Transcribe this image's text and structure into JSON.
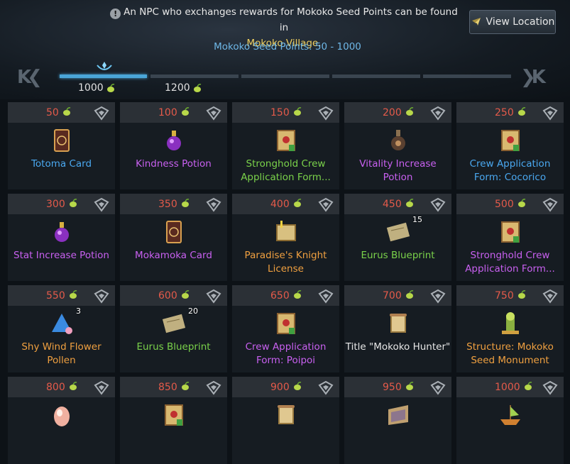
{
  "notice": {
    "text": "An NPC who exchanges rewards for Mokoko Seed Points can be found in",
    "location": "Mokoko Village",
    "period": "."
  },
  "view_location_label": "View Location",
  "points_range_label": "Mokoko Seed Points: 50 - 1000",
  "timeline": {
    "labels": [
      "1000",
      "1200"
    ],
    "active_segment": 1,
    "segment_count": 5
  },
  "colors": {
    "cost": "#e45a4a",
    "common": "#e6e6e6",
    "uncommon": "#7ad24a",
    "rare": "#4aa8f0",
    "epic": "#c860f0",
    "legendary": "#f0a040",
    "accent": "#4aa6d8"
  },
  "rewards": [
    {
      "cost": "50",
      "name": "Totoma Card",
      "rarity": "rare",
      "icon": "card-icon",
      "qty": ""
    },
    {
      "cost": "100",
      "name": "Kindness Potion",
      "rarity": "epic",
      "icon": "potion-icon",
      "qty": ""
    },
    {
      "cost": "150",
      "name": "Stronghold Crew Application Form...",
      "rarity": "uncommon",
      "icon": "application-form-icon",
      "qty": ""
    },
    {
      "cost": "200",
      "name": "Vitality Increase Potion",
      "rarity": "epic",
      "icon": "flask-icon",
      "qty": ""
    },
    {
      "cost": "250",
      "name": "Crew Application Form: Cocorico",
      "rarity": "rare",
      "icon": "application-form-icon",
      "qty": ""
    },
    {
      "cost": "300",
      "name": "Stat Increase Potion",
      "rarity": "epic",
      "icon": "potion-icon",
      "qty": ""
    },
    {
      "cost": "350",
      "name": "Mokamoka Card",
      "rarity": "epic",
      "icon": "card-icon",
      "qty": ""
    },
    {
      "cost": "400",
      "name": "Paradise's Knight License",
      "rarity": "legendary",
      "icon": "license-icon",
      "qty": ""
    },
    {
      "cost": "450",
      "name": "Eurus Blueprint",
      "rarity": "uncommon",
      "icon": "blueprint-icon",
      "qty": "15"
    },
    {
      "cost": "500",
      "name": "Stronghold Crew Application Form...",
      "rarity": "epic",
      "icon": "application-form-icon",
      "qty": ""
    },
    {
      "cost": "550",
      "name": "Shy Wind Flower Pollen",
      "rarity": "legendary",
      "icon": "pollen-icon",
      "qty": "3"
    },
    {
      "cost": "600",
      "name": "Eurus Blueprint",
      "rarity": "uncommon",
      "icon": "blueprint-icon",
      "qty": "20"
    },
    {
      "cost": "650",
      "name": "Crew Application Form: Poipoi",
      "rarity": "epic",
      "icon": "application-form-icon",
      "qty": ""
    },
    {
      "cost": "700",
      "name": "Title \"Mokoko Hunter\"",
      "rarity": "common",
      "icon": "scroll-icon",
      "qty": ""
    },
    {
      "cost": "750",
      "name": "Structure: Mokoko Seed Monument",
      "rarity": "legendary",
      "icon": "monument-icon",
      "qty": ""
    },
    {
      "cost": "800",
      "name": "",
      "rarity": "legendary",
      "icon": "egg-icon",
      "qty": ""
    },
    {
      "cost": "850",
      "name": "",
      "rarity": "uncommon",
      "icon": "application-form-icon",
      "qty": ""
    },
    {
      "cost": "900",
      "name": "",
      "rarity": "legendary",
      "icon": "scroll-icon",
      "qty": ""
    },
    {
      "cost": "950",
      "name": "",
      "rarity": "epic",
      "icon": "map-icon",
      "qty": ""
    },
    {
      "cost": "1000",
      "name": "",
      "rarity": "legendary",
      "icon": "ship-icon",
      "qty": ""
    }
  ]
}
